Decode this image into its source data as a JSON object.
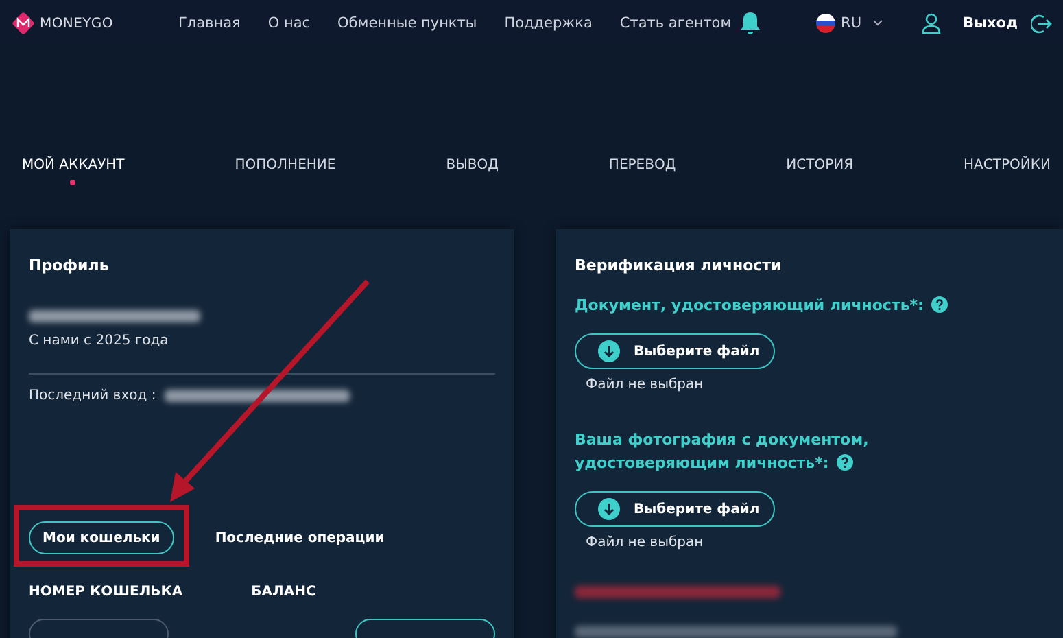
{
  "header": {
    "logo": "MONEYGO",
    "nav": [
      "Главная",
      "О нас",
      "Обменные пункты",
      "Поддержка",
      "Стать агентом"
    ],
    "language": "RU",
    "logout": "Выход"
  },
  "tabs": [
    {
      "label": "МОЙ АККАУНТ",
      "selected": true
    },
    {
      "label": "ПОПОЛНЕНИЕ",
      "selected": false
    },
    {
      "label": "ВЫВОД",
      "selected": false
    },
    {
      "label": "ПЕРЕВОД",
      "selected": false
    },
    {
      "label": "ИСТОРИЯ",
      "selected": false
    },
    {
      "label": "НАСТРОЙКИ",
      "selected": false
    }
  ],
  "profile": {
    "title": "Профиль",
    "since": "С нами с 2025 года",
    "last_login_label": "Последний вход :",
    "subtabs": [
      {
        "label": "Мои кошельки",
        "selected": true
      },
      {
        "label": "Последние операции",
        "selected": false
      }
    ],
    "columns": [
      "НОМЕР КОШЕЛЬКА",
      "БАЛАНС"
    ]
  },
  "verification": {
    "title": "Верификация личности",
    "fields": [
      {
        "label": "Документ, удостоверяющий личность*:",
        "button": "Выберите файл",
        "status": "Файл не выбран"
      },
      {
        "label": "Ваша фотография с документом, удостоверяющим личность*:",
        "button": "Выберите файл",
        "status": "Файл не выбран"
      }
    ]
  }
}
